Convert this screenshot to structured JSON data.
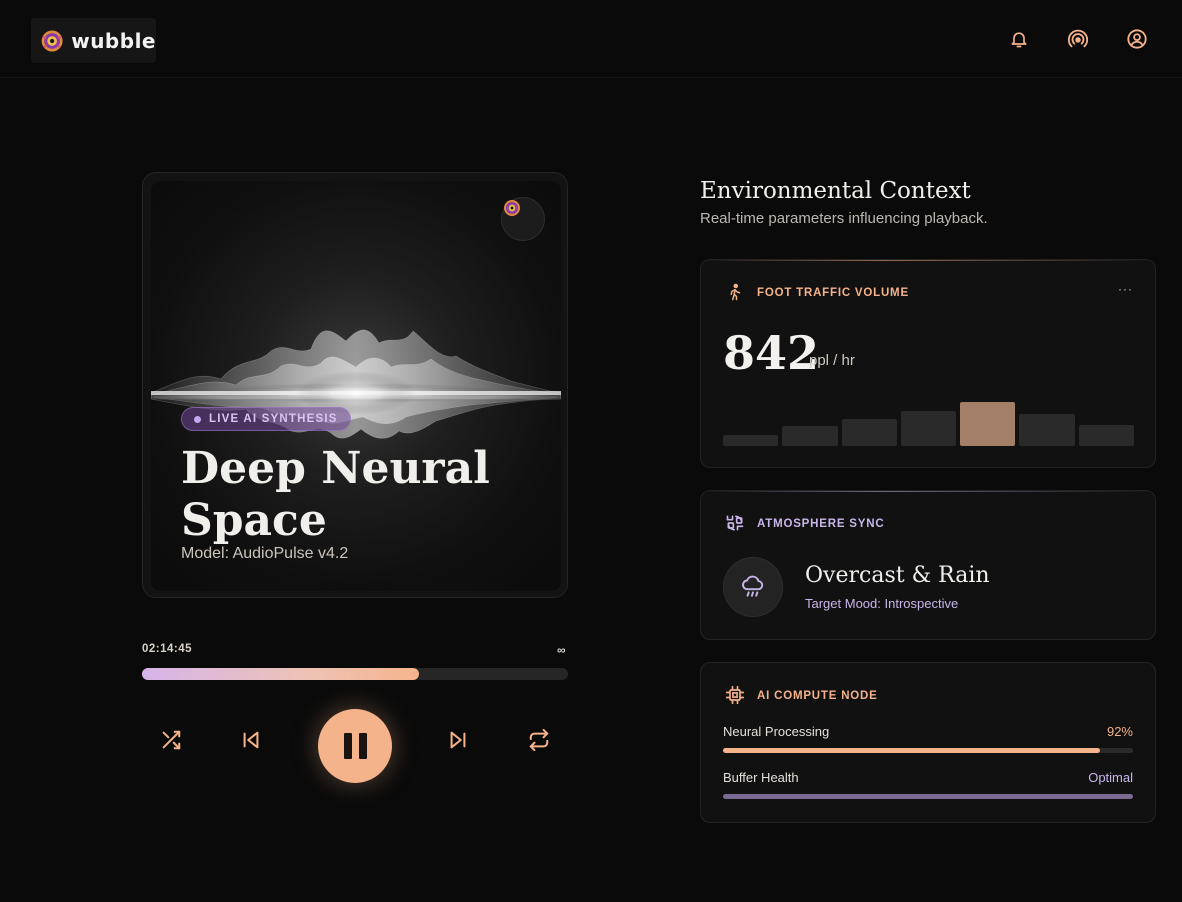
{
  "header": {
    "brand": "wubble",
    "icons": [
      "bell-icon",
      "broadcast-icon",
      "account-icon"
    ]
  },
  "player": {
    "badge": "LIVE AI SYNTHESIS",
    "title": "Deep Neural Space",
    "model": "Model: AudioPulse v4.2",
    "current_time": "02:14:45",
    "end_time": "∞",
    "progress": 0.65,
    "controls": [
      "shuffle-icon",
      "skip-back-icon",
      "pause-icon",
      "skip-forward-icon",
      "repeat-icon"
    ]
  },
  "environment": {
    "title": "Environmental Context",
    "subtitle": "Real-time parameters influencing playback.",
    "foot_traffic": {
      "label": "FOOT TRAFFIC VOLUME",
      "value": "842",
      "unit": "ppl / hr",
      "more": "···",
      "bar_levels": [
        0.2,
        0.36,
        0.48,
        0.62,
        0.78,
        0.58,
        0.38
      ],
      "highlight_index": 4
    },
    "atmosphere": {
      "label": "ATMOSPHERE SYNC",
      "condition": "Overcast & Rain",
      "mood": "Target Mood: Introspective"
    },
    "compute": {
      "label": "AI COMPUTE NODE",
      "metrics": [
        {
          "label": "Neural Processing",
          "value": "92%",
          "level": 0.92
        },
        {
          "label": "Buffer Health",
          "value": "Optimal",
          "level": 1.0
        }
      ]
    }
  },
  "colors": {
    "accent_peach": "#f4b38a",
    "accent_lavender": "#c8b6ea",
    "bar_highlight": "#a37f67",
    "bar_default": "#2a2a2a"
  }
}
